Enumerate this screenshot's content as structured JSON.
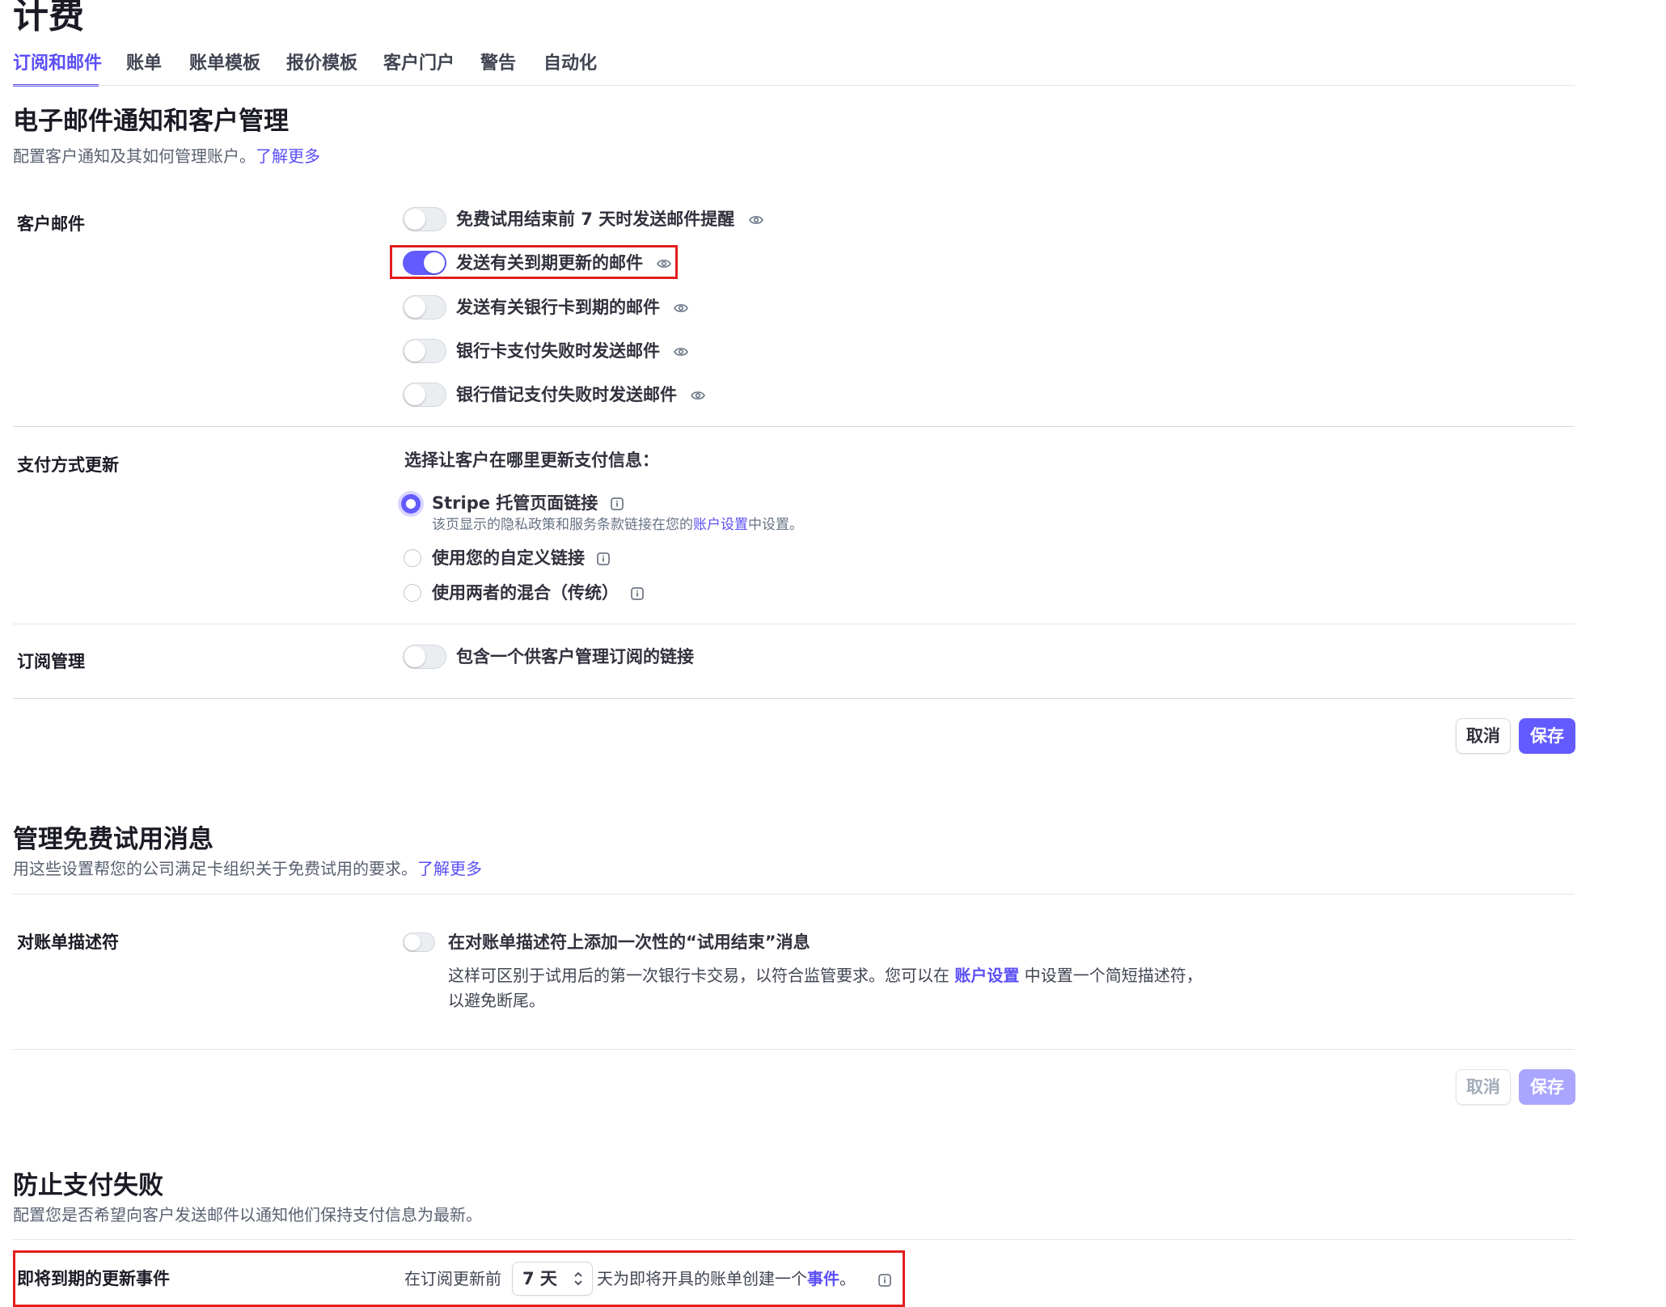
{
  "page": {
    "title": "计费"
  },
  "tabs": [
    {
      "label": "订阅和邮件",
      "active": true
    },
    {
      "label": "账单"
    },
    {
      "label": "账单模板"
    },
    {
      "label": "报价模板"
    },
    {
      "label": "客户门户"
    },
    {
      "label": "警告"
    },
    {
      "label": "自动化"
    }
  ],
  "email_section": {
    "title": "电子邮件通知和客户管理",
    "description": "配置客户通知及其如何管理账户。",
    "learn_more": "了解更多",
    "customer_emails": {
      "label": "客户邮件",
      "options": [
        {
          "label": "免费试用结束前 7 天时发送邮件提醒",
          "enabled": false
        },
        {
          "label": "发送有关到期更新的邮件",
          "enabled": true
        },
        {
          "label": "发送有关银行卡到期的邮件",
          "enabled": false
        },
        {
          "label": "银行卡支付失败时发送邮件",
          "enabled": false
        },
        {
          "label": "银行借记支付失败时发送邮件",
          "enabled": false
        }
      ]
    },
    "payment_method_update": {
      "label": "支付方式更新",
      "prompt": "选择让客户在哪里更新支付信息：",
      "options": [
        {
          "label": "Stripe 托管页面链接",
          "selected": true
        },
        {
          "label": "使用您的自定义链接",
          "selected": false
        },
        {
          "label": "使用两者的混合（传统）",
          "selected": false
        }
      ],
      "hosted_note_before": "该页显示的隐私政策和服务条款链接在您的",
      "hosted_note_link": "账户设置",
      "hosted_note_after": "中设置。"
    },
    "subscription_management": {
      "label": "订阅管理",
      "option": "包含一个供客户管理订阅的链接",
      "enabled": false
    },
    "cancel_label": "取消",
    "save_label": "保存"
  },
  "trial_section": {
    "title": "管理免费试用消息",
    "description": "用这些设置帮您的公司满足卡组织关于免费试用的要求。",
    "learn_more": "了解更多",
    "statement_descriptor": {
      "label": "对账单描述符",
      "option": "在对账单描述符上添加一次性的“试用结束”消息",
      "enabled": false,
      "help_line1_before": "这样可区别于试用后的第一次银行卡交易，以符合监管要求。您可以在 ",
      "help_link": "账户设置",
      "help_line1_after": " 中设置一个简短描述符，",
      "help_line2": "以避免断尾。"
    },
    "cancel_label": "取消",
    "save_label": "保存"
  },
  "prevent_section": {
    "title": "防止支付失败",
    "description": "配置您是否希望向客户发送邮件以通知他们保持支付信息为最新。",
    "upcoming_renewal": {
      "label": "即将到期的更新事件",
      "text_before": "在订阅更新前",
      "days_value": "7 天",
      "text_after": "天为即将开具的账单创建一个",
      "event_link": "事件",
      "period": "。"
    }
  },
  "colors": {
    "accent": "#635bff",
    "highlight": "#e21d1d"
  }
}
